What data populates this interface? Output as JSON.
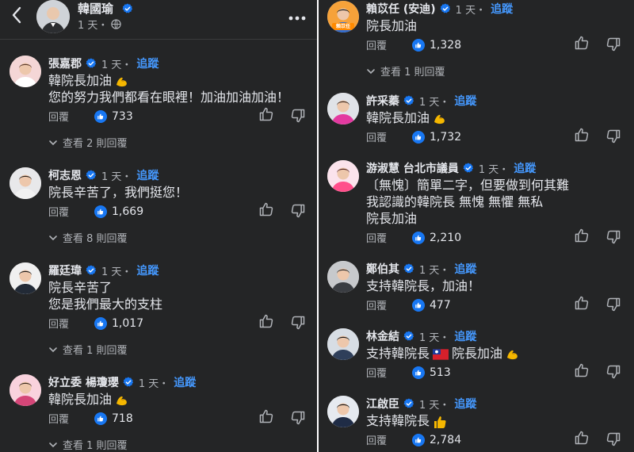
{
  "header": {
    "name": "韓國瑜",
    "meta": "1 天・"
  },
  "common": {
    "time": "1 天・",
    "follow": "追蹤",
    "reply": "回覆"
  },
  "left_comments": [
    {
      "name": "張嘉郡",
      "lines": [
        "韓院長加油",
        "您的努力我們都看在眼裡！加油加油加油！"
      ],
      "likes": "733",
      "replies": "查看 2 則回覆",
      "emoji_line": 0,
      "emoji": "muscle"
    },
    {
      "name": "柯志恩",
      "lines": [
        "院長辛苦了，我們挺您！"
      ],
      "likes": "1,669",
      "replies": "查看 8 則回覆"
    },
    {
      "name": "羅廷瑋",
      "lines": [
        "院長辛苦了",
        "您是我們最大的支柱"
      ],
      "likes": "1,017",
      "replies": "查看 1 則回覆"
    },
    {
      "name": "好立委 楊瓊瓔",
      "lines": [
        "韓院長加油"
      ],
      "likes": "718",
      "replies": "查看 1 則回覆",
      "emoji_line": 0,
      "emoji": "muscle"
    }
  ],
  "right_comments": [
    {
      "name": "賴苡任 (安迪)",
      "lines": [
        "院長加油"
      ],
      "likes": "1,328",
      "replies": "查看 1 則回覆",
      "avatar_label": "賴苡任"
    },
    {
      "name": "許采蓁",
      "lines": [
        "韓院長加油"
      ],
      "likes": "1,732",
      "emoji_line": 0,
      "emoji": "muscle"
    },
    {
      "name": "游淑慧 台北市議員",
      "lines": [
        "〔無愧〕簡單二字，但要做到何其難",
        "我認識的韓院長 無愧 無懼  無私",
        "院長加油"
      ],
      "likes": "2,210"
    },
    {
      "name": "鄭伯其",
      "lines": [
        "支持韓院長，加油！"
      ],
      "likes": "477"
    },
    {
      "name": "林金結",
      "lines": [
        "支持韓院長 院長加油"
      ],
      "likes": "513",
      "emoji": "flag-muscle"
    },
    {
      "name": "江啟臣",
      "lines": [
        "支持韓院長"
      ],
      "likes": "2,784",
      "emoji_line": 0,
      "emoji": "thumbs"
    }
  ],
  "colors": {
    "background": "#242526",
    "text": "#e4e6eb",
    "secondary": "#b0b3b8",
    "accent": "#4599ff",
    "like": "#1877f2"
  },
  "icons": {
    "back": "chevron-left-icon",
    "verified": "verified-badge-icon",
    "globe": "globe-icon",
    "more": "more-horizontal-icon",
    "like": "thumbs-up-icon",
    "dislike": "thumbs-down-icon",
    "expand": "chevron-down-icon"
  }
}
